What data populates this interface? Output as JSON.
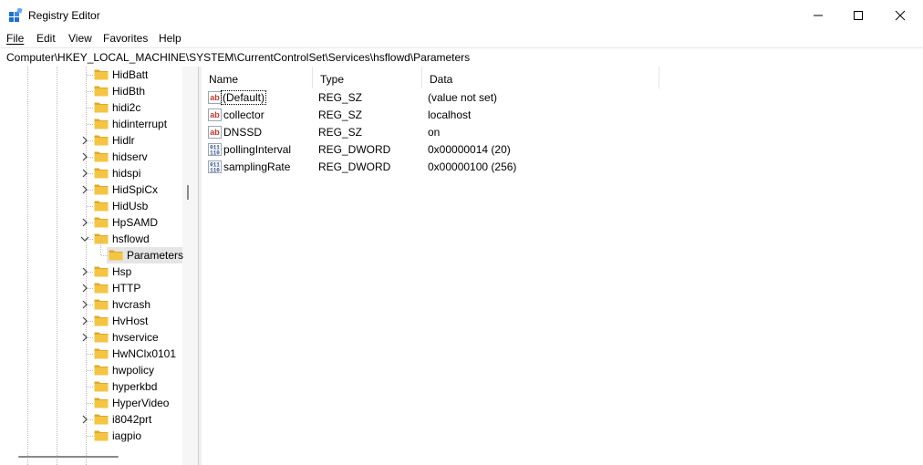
{
  "window": {
    "title": "Registry Editor",
    "icon": "registry-editor-icon",
    "controls": [
      "minimize-icon",
      "maximize-icon",
      "close-icon"
    ]
  },
  "menu": {
    "file": "File",
    "edit": "Edit",
    "view": "View",
    "favorites": "Favorites",
    "help": "Help"
  },
  "address": "Computer\\HKEY_LOCAL_MACHINE\\SYSTEM\\CurrentControlSet\\Services\\hsflowd\\Parameters",
  "tree": {
    "items": [
      {
        "label": "HidBatt",
        "expander": "none",
        "level": 0
      },
      {
        "label": "HidBth",
        "expander": "none",
        "level": 0
      },
      {
        "label": "hidi2c",
        "expander": "none",
        "level": 0
      },
      {
        "label": "hidinterrupt",
        "expander": "none",
        "level": 0
      },
      {
        "label": "Hidlr",
        "expander": "collapsed",
        "level": 0
      },
      {
        "label": "hidserv",
        "expander": "collapsed",
        "level": 0
      },
      {
        "label": "hidspi",
        "expander": "collapsed",
        "level": 0
      },
      {
        "label": "HidSpiCx",
        "expander": "collapsed",
        "level": 0
      },
      {
        "label": "HidUsb",
        "expander": "none",
        "level": 0
      },
      {
        "label": "HpSAMD",
        "expander": "collapsed",
        "level": 0
      },
      {
        "label": "hsflowd",
        "expander": "expanded",
        "level": 0
      },
      {
        "label": "Parameters",
        "expander": "none",
        "level": 1,
        "selected": true
      },
      {
        "label": "Hsp",
        "expander": "collapsed",
        "level": 0
      },
      {
        "label": "HTTP",
        "expander": "collapsed",
        "level": 0
      },
      {
        "label": "hvcrash",
        "expander": "collapsed",
        "level": 0
      },
      {
        "label": "HvHost",
        "expander": "collapsed",
        "level": 0
      },
      {
        "label": "hvservice",
        "expander": "collapsed",
        "level": 0
      },
      {
        "label": "HwNClx0101",
        "expander": "none",
        "level": 0
      },
      {
        "label": "hwpolicy",
        "expander": "none",
        "level": 0
      },
      {
        "label": "hyperkbd",
        "expander": "none",
        "level": 0
      },
      {
        "label": "HyperVideo",
        "expander": "none",
        "level": 0
      },
      {
        "label": "i8042prt",
        "expander": "collapsed",
        "level": 0
      },
      {
        "label": "iagpio",
        "expander": "none",
        "level": 0
      }
    ]
  },
  "list": {
    "columns": {
      "name": "Name",
      "type": "Type",
      "data": "Data"
    },
    "values": [
      {
        "name": "(Default)",
        "type": "REG_SZ",
        "data": "(value not set)",
        "icon": "string-value-icon"
      },
      {
        "name": "collector",
        "type": "REG_SZ",
        "data": "localhost",
        "icon": "string-value-icon"
      },
      {
        "name": "DNSSD",
        "type": "REG_SZ",
        "data": "on",
        "icon": "string-value-icon"
      },
      {
        "name": "pollingInterval",
        "type": "REG_DWORD",
        "data": "0x00000014 (20)",
        "icon": "binary-value-icon"
      },
      {
        "name": "samplingRate",
        "type": "REG_DWORD",
        "data": "0x00000100 (256)",
        "icon": "binary-value-icon"
      }
    ]
  },
  "colors": {
    "folder": "#f4c542",
    "folder_dark": "#e0a92a",
    "string_icon_red": "#c0392b",
    "binary_icon_blue": "#2b4d8c",
    "selection": "#e5e5e5"
  }
}
